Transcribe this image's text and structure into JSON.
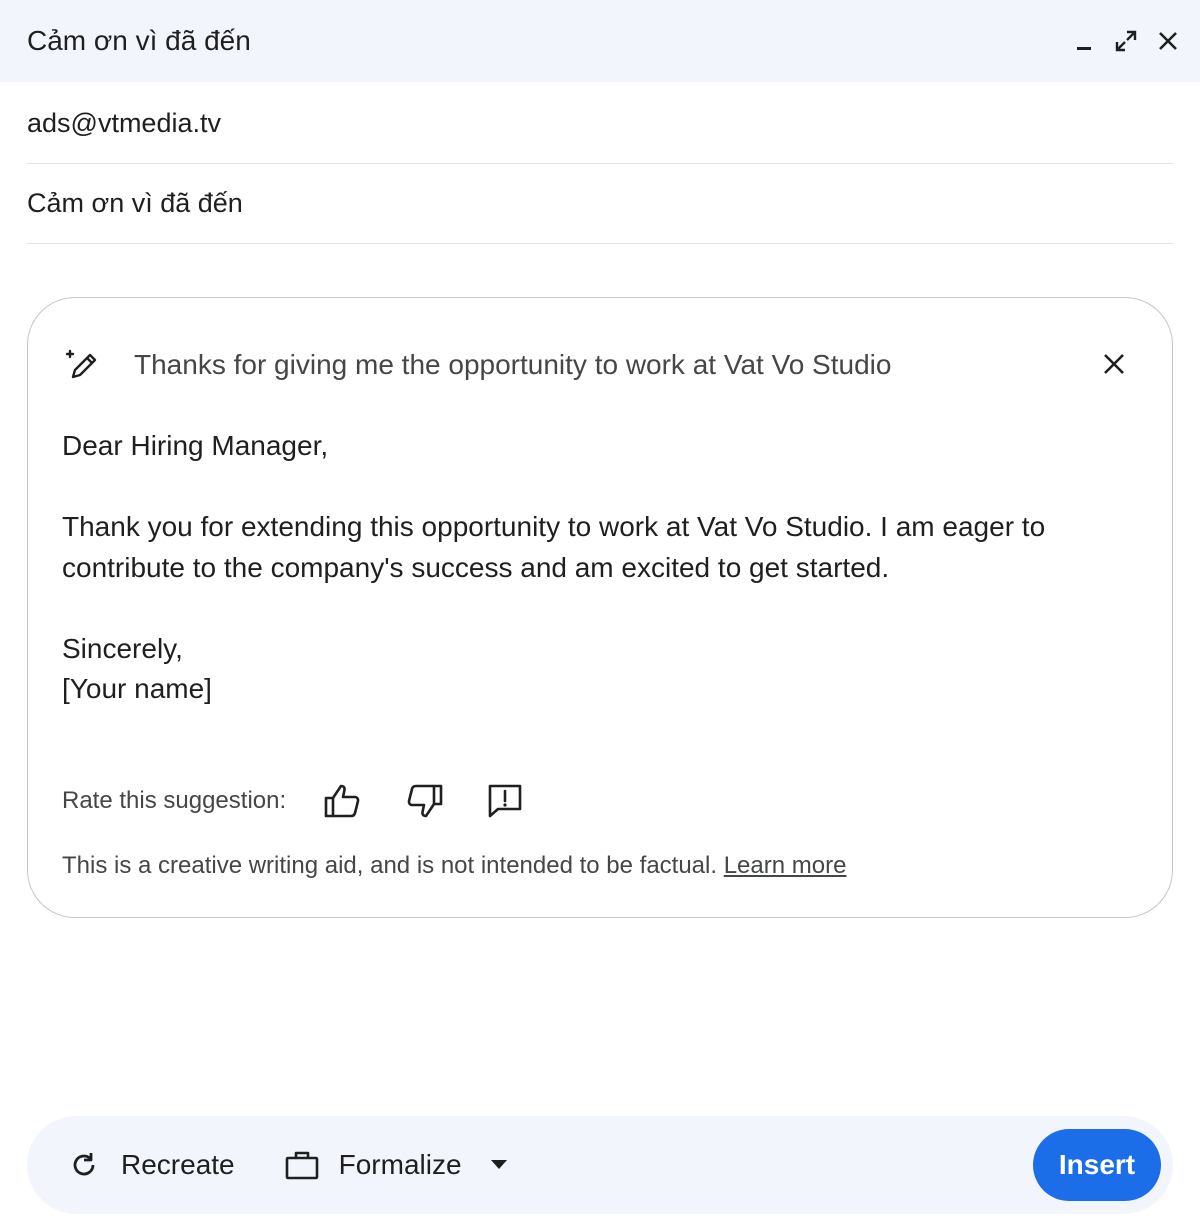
{
  "window": {
    "title": "Cảm ơn vì đã đến",
    "controls": [
      "minimize-icon",
      "expand-icon",
      "close-icon"
    ]
  },
  "compose": {
    "to": "ads@vtmedia.tv",
    "subject": "Cảm ơn vì đã đến"
  },
  "suggestion": {
    "prompt": "Thanks for giving me the opportunity to work at Vat Vo Studio",
    "body": {
      "greeting": "Dear Hiring Manager,",
      "paragraph_line1": "Thank you for extending this opportunity to work at Vat Vo Studio. I am eager to",
      "paragraph_line2": "contribute to the company's success and am excited to get started.",
      "closing": "Sincerely,",
      "signature": "[Your name]"
    },
    "rate_label": "Rate this suggestion:",
    "disclaimer": "This is a creative writing aid, and is not intended to be factual.",
    "learn_more": "Learn more"
  },
  "toolbar": {
    "recreate_label": "Recreate",
    "formalize_label": "Formalize",
    "insert_label": "Insert"
  },
  "colors": {
    "accent": "#1b6ee8",
    "header_bg": "#f2f6fc"
  }
}
